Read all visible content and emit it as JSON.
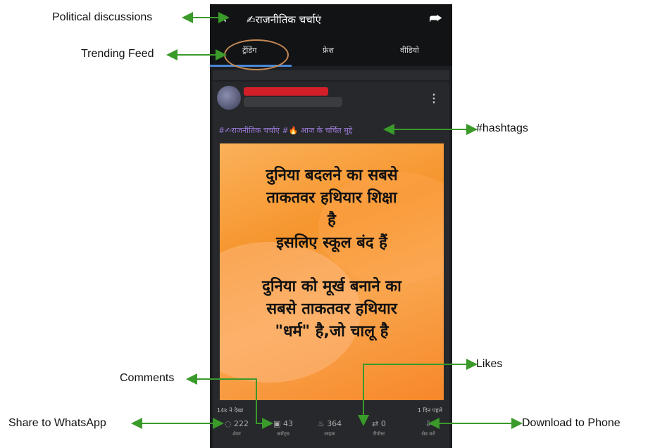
{
  "annotations": {
    "political": "Political discussions",
    "trending": "Trending Feed",
    "hashtags": "#hashtags",
    "likes": "Likes",
    "comments": "Comments",
    "share_whatsapp": "Share to WhatsApp",
    "download": "Download to Phone"
  },
  "header": {
    "back_icon": "‹",
    "title": "✍राजनीतिक चर्चाएं",
    "share_icon": "⮫"
  },
  "tabs": [
    "ट्रेंडिंग",
    "फ्रेश",
    "वीडियो"
  ],
  "post": {
    "hashtags": "#✍राजनीतिक चर्चाएं #🔥 आज के चर्चित मुद्दे",
    "lines_top": [
      "दुनिया बदलने का सबसे",
      "ताकतवर हथियार शिक्षा",
      "है",
      "इसलिए स्कूल बंद हैं"
    ],
    "lines_bottom": [
      "दुनिया को मूर्ख बनाने का",
      "सबसे ताकतवर हथियार",
      "\"धर्म\" है,जो चालू है"
    ],
    "views": "14k ने देखा",
    "time": "1 दिन पहले"
  },
  "actions": {
    "share": {
      "icon": "whatsapp-icon",
      "count": "222",
      "label": "शेयर"
    },
    "comment": {
      "icon": "comment-icon",
      "count": "43",
      "label": "कमेंट्स"
    },
    "like": {
      "icon": "like-icon",
      "count": "364",
      "label": "लाइक"
    },
    "repost": {
      "icon": "repost-icon",
      "count": "0",
      "label": "रीपोस्ट"
    },
    "save": {
      "icon": "download-icon",
      "label": "सेव करें"
    }
  },
  "colors": {
    "arrow": "#3a9a2a",
    "tab_underline": "#4a88d8",
    "post_bg": "#f6952d"
  }
}
